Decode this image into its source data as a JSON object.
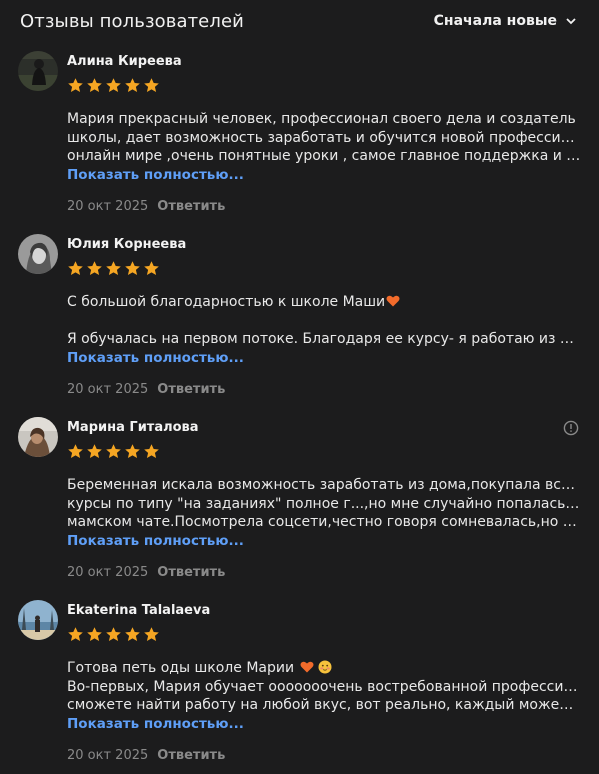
{
  "header": {
    "title": "Отзывы пользователей",
    "sort_label": "Сначала новые"
  },
  "colors": {
    "background": "#1c1c1d",
    "star": "#f5a623",
    "link": "#5f9ff7",
    "muted": "#8a8a8a",
    "heart": "#f26b2b"
  },
  "common": {
    "show_more": "Показать полностью...",
    "reply": "Ответить"
  },
  "reviews": [
    {
      "name": "Алина Киреева",
      "rating": 5,
      "line1": "Мария прекрасный человек, профессионал своего дела и создатель",
      "line2": "школы, дает возможность заработать и обучится новой профессии в",
      "line3": "онлайн мире ,очень понятные уроки , самое главное поддержка и обратная связь",
      "date": "20 окт 2025",
      "avatar_icon": "user-photo-avatar"
    },
    {
      "name": "Юлия Корнеева",
      "rating": 5,
      "line1": "С большой благодарностью к школе Маши",
      "line2": "",
      "line3": "Я обучалась на первом потоке. Благодаря ее курсу- я работаю из дома, и это прекрасно",
      "date": "20 окт 2025",
      "avatar_icon": "user-photo-avatar"
    },
    {
      "name": "Марина Гиталова",
      "rating": 5,
      "line1": "Беременная искала возможность заработать из дома,покупала всякие",
      "line2": "курсы по типу \"на заданиях\" полное г...,но мне случайно попалась Маша в",
      "line3": "мамском чате.Посмотрела соцсети,честно говоря сомневалась,но решилась",
      "date": "20 окт 2025",
      "avatar_icon": "user-photo-avatar",
      "has_info": true
    },
    {
      "name": "Ekaterina Talalaeva",
      "rating": 5,
      "line1": "Готова петь оды школе Марии",
      "line2": "Во-первых, Мария обучает ооооооочень востребованной профессии, где вы",
      "line3": "сможете найти работу на любой вкус, вот реально, каждый может найти себе по душе",
      "date": "20 окт 2025",
      "avatar_icon": "user-photo-avatar"
    }
  ]
}
